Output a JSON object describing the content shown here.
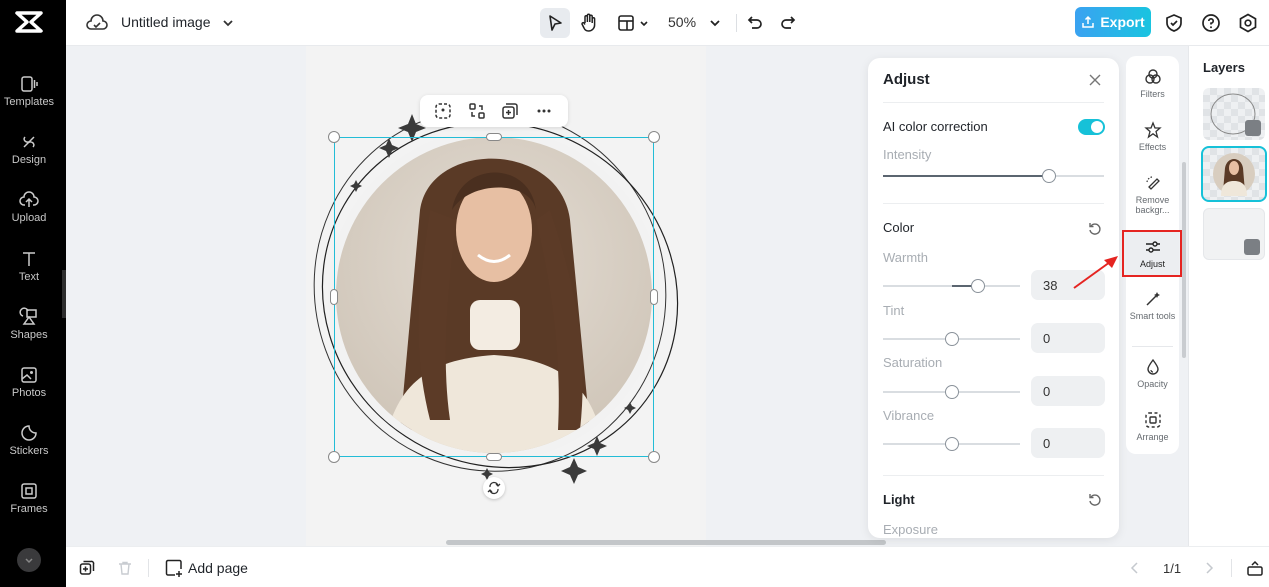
{
  "app": {
    "logo": "capcut-logo",
    "doc_title": "Untitled image",
    "zoom_level": "50%"
  },
  "topbar": {
    "tools": [
      "select-tool",
      "hand-tool",
      "layout-tool",
      "undo",
      "redo"
    ],
    "export_label": "Export",
    "right_icons": [
      "shield-check-icon",
      "help-icon",
      "settings-icon"
    ]
  },
  "sidebar": {
    "items": [
      {
        "label": "Templates",
        "icon": "templates-icon"
      },
      {
        "label": "Design",
        "icon": "design-icon"
      },
      {
        "label": "Upload",
        "icon": "upload-icon"
      },
      {
        "label": "Text",
        "icon": "text-icon"
      },
      {
        "label": "Shapes",
        "icon": "shapes-icon"
      },
      {
        "label": "Photos",
        "icon": "photos-icon"
      },
      {
        "label": "Stickers",
        "icon": "stickers-icon"
      },
      {
        "label": "Frames",
        "icon": "frames-icon"
      }
    ]
  },
  "selection_toolbar": [
    "cutout-icon",
    "replace-icon",
    "duplicate-icon",
    "more-icon"
  ],
  "adjust": {
    "title": "Adjust",
    "ai_color_correction": {
      "label": "AI color correction",
      "enabled": true
    },
    "intensity": {
      "label": "Intensity",
      "value_fraction": 0.75
    },
    "color_section": "Color",
    "warmth": {
      "label": "Warmth",
      "value": "38"
    },
    "tint": {
      "label": "Tint",
      "value": "0"
    },
    "saturation": {
      "label": "Saturation",
      "value": "0"
    },
    "vibrance": {
      "label": "Vibrance",
      "value": "0"
    },
    "light_section": "Light",
    "exposure": {
      "label": "Exposure"
    }
  },
  "tools": {
    "items": [
      {
        "label": "Filters"
      },
      {
        "label": "Effects"
      },
      {
        "label": "Remove backgr..."
      },
      {
        "label": "Adjust",
        "active": true
      },
      {
        "label": "Smart tools"
      },
      {
        "label": "Opacity"
      },
      {
        "label": "Arrange"
      }
    ]
  },
  "layers": {
    "title": "Layers",
    "items": [
      "frame-layer",
      "photo-layer",
      "background-layer"
    ]
  },
  "bottombar": {
    "add_page": "Add page",
    "page_indicator": "1/1"
  }
}
